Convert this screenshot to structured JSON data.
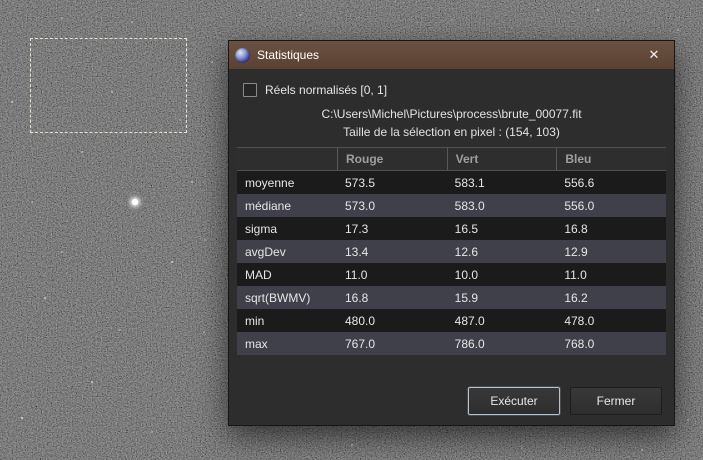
{
  "dialog": {
    "title": "Statistiques",
    "close_glyph": "✕",
    "checkbox_label": "Réels normalisés [0, 1]",
    "file_path": "C:\\Users\\Michel\\Pictures\\process\\brute_00077.fit",
    "selection_info": "Taille de la sélection en pixel : (154, 103)",
    "buttons": {
      "execute": "Exécuter",
      "close": "Fermer"
    }
  },
  "table": {
    "columns": [
      "",
      "Rouge",
      "Vert",
      "Bleu"
    ],
    "rows": [
      {
        "label": "moyenne",
        "values": [
          "573.5",
          "583.1",
          "556.6"
        ]
      },
      {
        "label": "médiane",
        "values": [
          "573.0",
          "583.0",
          "556.0"
        ]
      },
      {
        "label": "sigma",
        "values": [
          "17.3",
          "16.5",
          "16.8"
        ]
      },
      {
        "label": "avgDev",
        "values": [
          "13.4",
          "12.6",
          "12.9"
        ]
      },
      {
        "label": "MAD",
        "values": [
          "11.0",
          "10.0",
          "11.0"
        ]
      },
      {
        "label": "sqrt(BWMV)",
        "values": [
          "16.8",
          "15.9",
          "16.2"
        ]
      },
      {
        "label": "min",
        "values": [
          "480.0",
          "487.0",
          "478.0"
        ]
      },
      {
        "label": "max",
        "values": [
          "767.0",
          "786.0",
          "768.0"
        ]
      }
    ]
  }
}
